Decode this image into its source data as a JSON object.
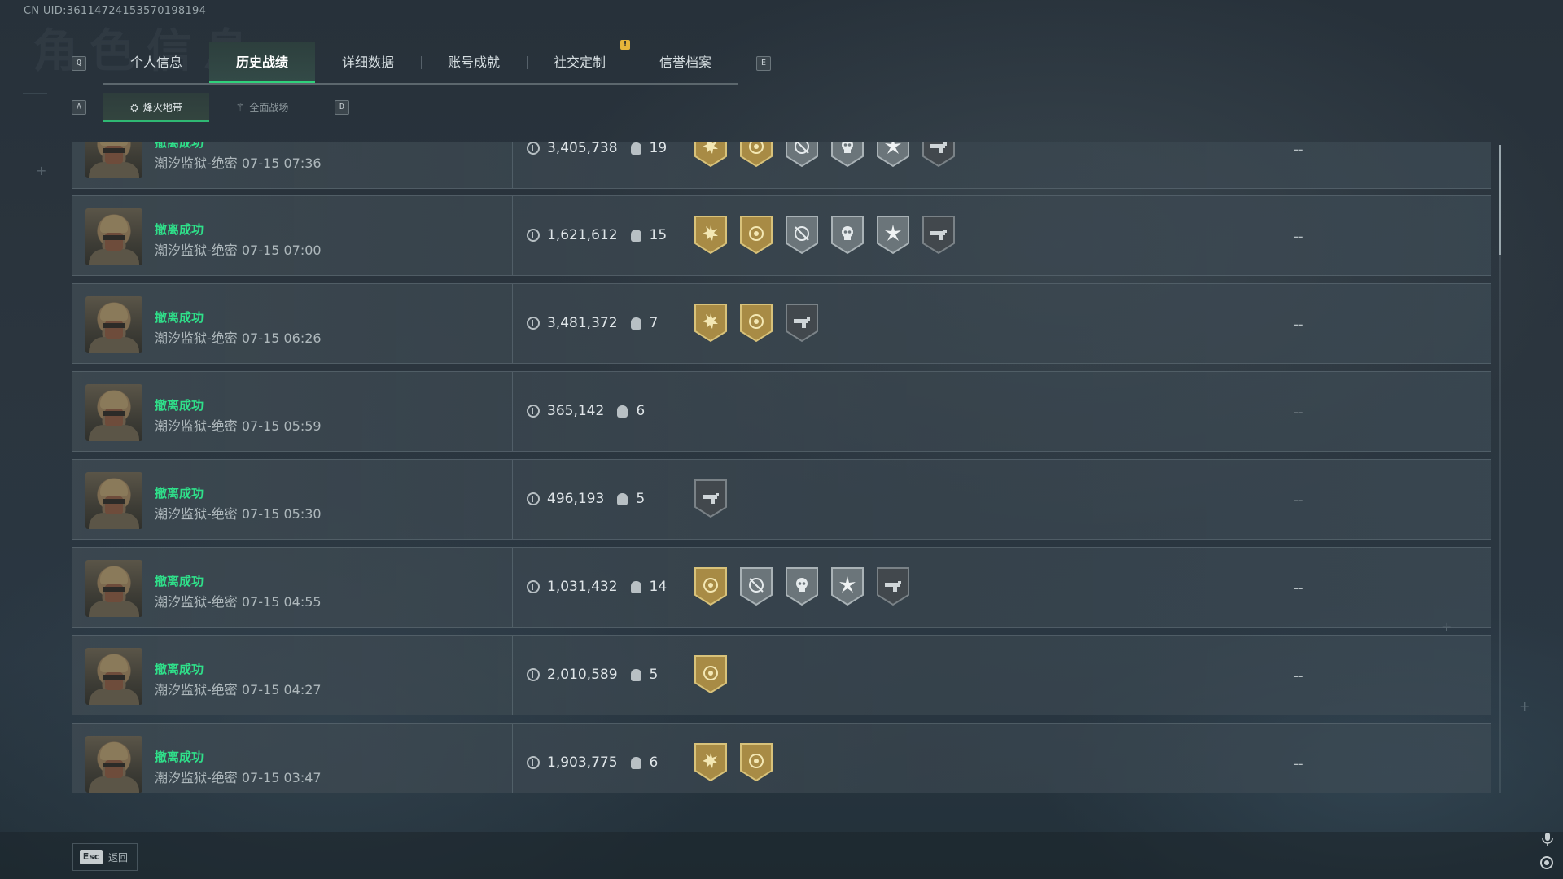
{
  "header": {
    "uid": "CN UID:36114724153570198194"
  },
  "tabs": {
    "left_key": "Q",
    "right_key": "E",
    "alert": "!",
    "items": [
      {
        "label": "个人信息"
      },
      {
        "label": "历史战绩",
        "active": true
      },
      {
        "label": "详细数据"
      },
      {
        "label": "账号成就"
      },
      {
        "label": "社交定制"
      },
      {
        "label": "信誉档案"
      }
    ]
  },
  "subtabs": {
    "left_key": "A",
    "right_key": "D",
    "items": [
      {
        "label": "烽火地带",
        "active": true
      },
      {
        "label": "全面战场"
      }
    ]
  },
  "records": [
    {
      "status": "撤离成功",
      "map": "潮汐监狱-绝密",
      "time": "07-15 07:36",
      "value": "3,405,738",
      "kills": "19",
      "badges": [
        "gold-sun",
        "gold-coin",
        "gray-crosshair",
        "gray-skull",
        "gray-burst",
        "dark-gun"
      ],
      "result": "--"
    },
    {
      "status": "撤离成功",
      "map": "潮汐监狱-绝密",
      "time": "07-15 07:00",
      "value": "1,621,612",
      "kills": "15",
      "badges": [
        "gold-sun",
        "gold-coin",
        "gray-crosshair",
        "gray-skull",
        "gray-burst",
        "dark-gun"
      ],
      "result": "--"
    },
    {
      "status": "撤离成功",
      "map": "潮汐监狱-绝密",
      "time": "07-15 06:26",
      "value": "3,481,372",
      "kills": "7",
      "badges": [
        "gold-sun",
        "gold-coin",
        "dark-gun"
      ],
      "result": "--"
    },
    {
      "status": "撤离成功",
      "map": "潮汐监狱-绝密",
      "time": "07-15 05:59",
      "value": "365,142",
      "kills": "6",
      "badges": [],
      "result": "--"
    },
    {
      "status": "撤离成功",
      "map": "潮汐监狱-绝密",
      "time": "07-15 05:30",
      "value": "496,193",
      "kills": "5",
      "badges": [
        "dark-gun"
      ],
      "result": "--"
    },
    {
      "status": "撤离成功",
      "map": "潮汐监狱-绝密",
      "time": "07-15 04:55",
      "value": "1,031,432",
      "kills": "14",
      "badges": [
        "gold-coin",
        "gray-crosshair",
        "gray-skull",
        "gray-burst",
        "dark-gun"
      ],
      "result": "--"
    },
    {
      "status": "撤离成功",
      "map": "潮汐监狱-绝密",
      "time": "07-15 04:27",
      "value": "2,010,589",
      "kills": "5",
      "badges": [
        "gold-coin"
      ],
      "result": "--"
    },
    {
      "status": "撤离成功",
      "map": "潮汐监狱-绝密",
      "time": "07-15 03:47",
      "value": "1,903,775",
      "kills": "6",
      "badges": [
        "gold-sun",
        "gold-coin"
      ],
      "result": "--"
    }
  ],
  "footer": {
    "esc_key": "Esc",
    "back_label": "返回"
  },
  "colors": {
    "accent_green": "#2fe08a",
    "tab_underline": "#2fd17b",
    "gold_badge": "#b59a4e",
    "gray_badge": "#7d878c",
    "dark_badge": "#474d52"
  },
  "icons": {
    "value": "coin-icon",
    "kills": "skull-icon",
    "subtab_1": "fire-zone-icon",
    "subtab_2": "battlefield-icon",
    "mic": "microphone-icon",
    "settings": "settings-icon"
  }
}
